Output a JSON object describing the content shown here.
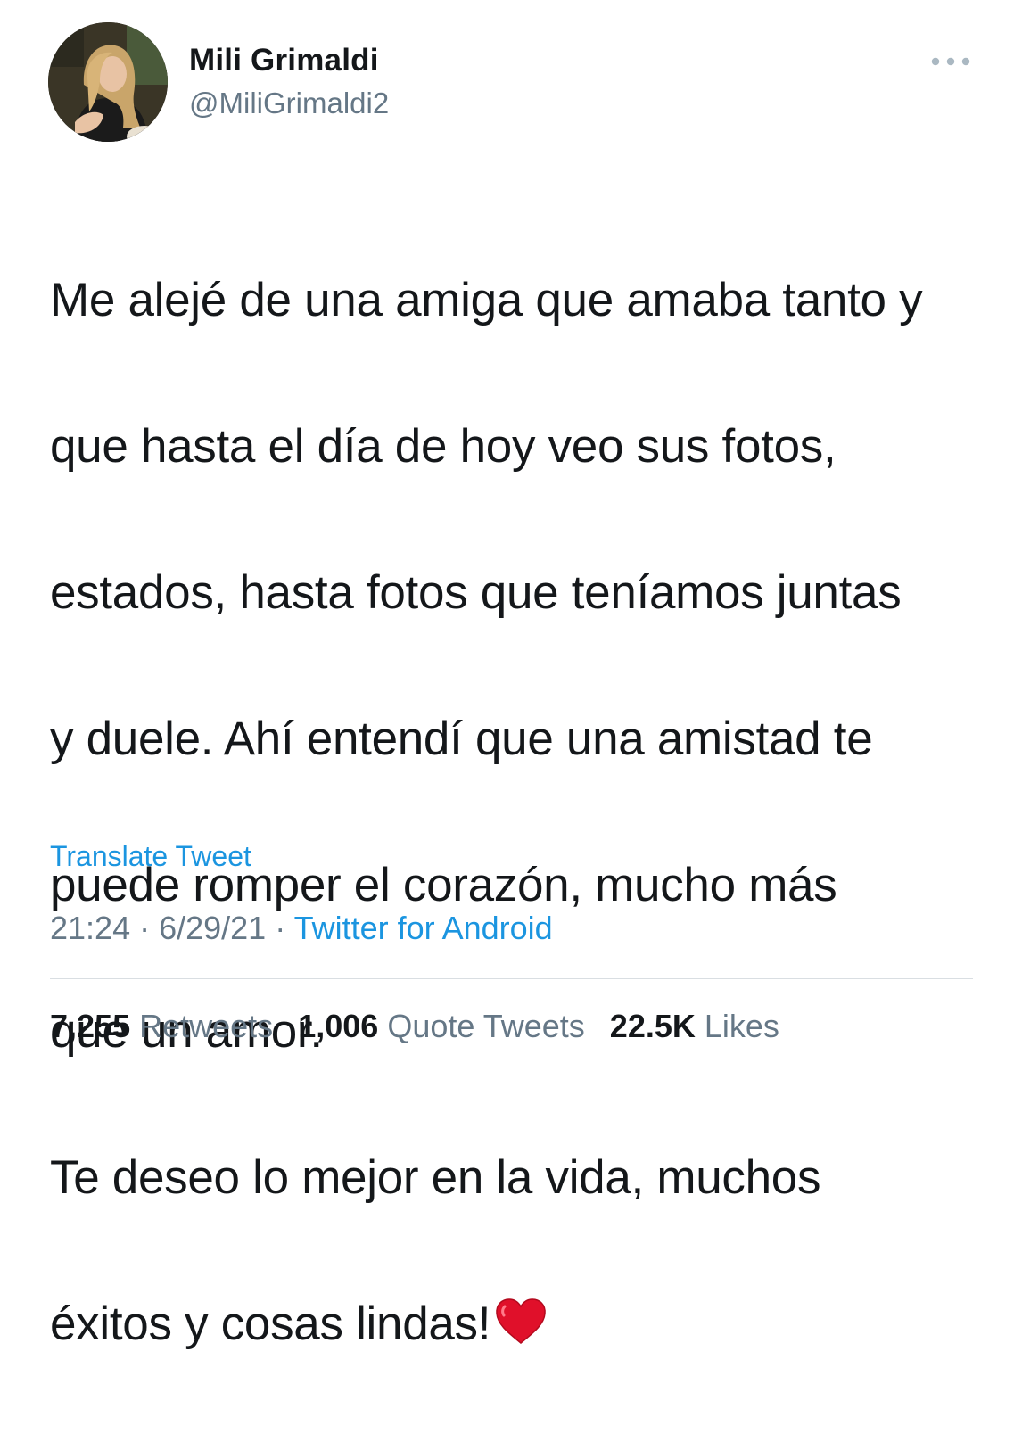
{
  "author": {
    "display_name": "Mili Grimaldi",
    "handle": "@MiliGrimaldi2",
    "avatar_icon": "profile-photo"
  },
  "more_icon": "more-horizontal-icon",
  "tweet": {
    "lines": [
      "Me alejé de una amiga que amaba tanto y",
      "que hasta el día de hoy veo sus fotos,",
      "estados, hasta fotos que teníamos juntas",
      "y duele. Ahí entendí que una amistad te",
      "puede romper el corazón, mucho más",
      "que un amor.",
      "Te deseo lo mejor en la vida, muchos",
      "éxitos y cosas lindas!"
    ],
    "emoji": "red-heart"
  },
  "translate_label": "Translate Tweet",
  "meta": {
    "time": "21:24",
    "separator": " · ",
    "date": "6/29/21",
    "source": "Twitter for Android"
  },
  "stats": {
    "retweets": {
      "count": "7,255",
      "label": "Retweets"
    },
    "quote_tweets": {
      "count": "1,006",
      "label": "Quote Tweets"
    },
    "likes": {
      "count": "22.5K",
      "label": "Likes"
    }
  },
  "colors": {
    "link": "#1b95e0",
    "secondary_text": "#657786",
    "primary_text": "#14171a",
    "heart": "#e0102a"
  }
}
